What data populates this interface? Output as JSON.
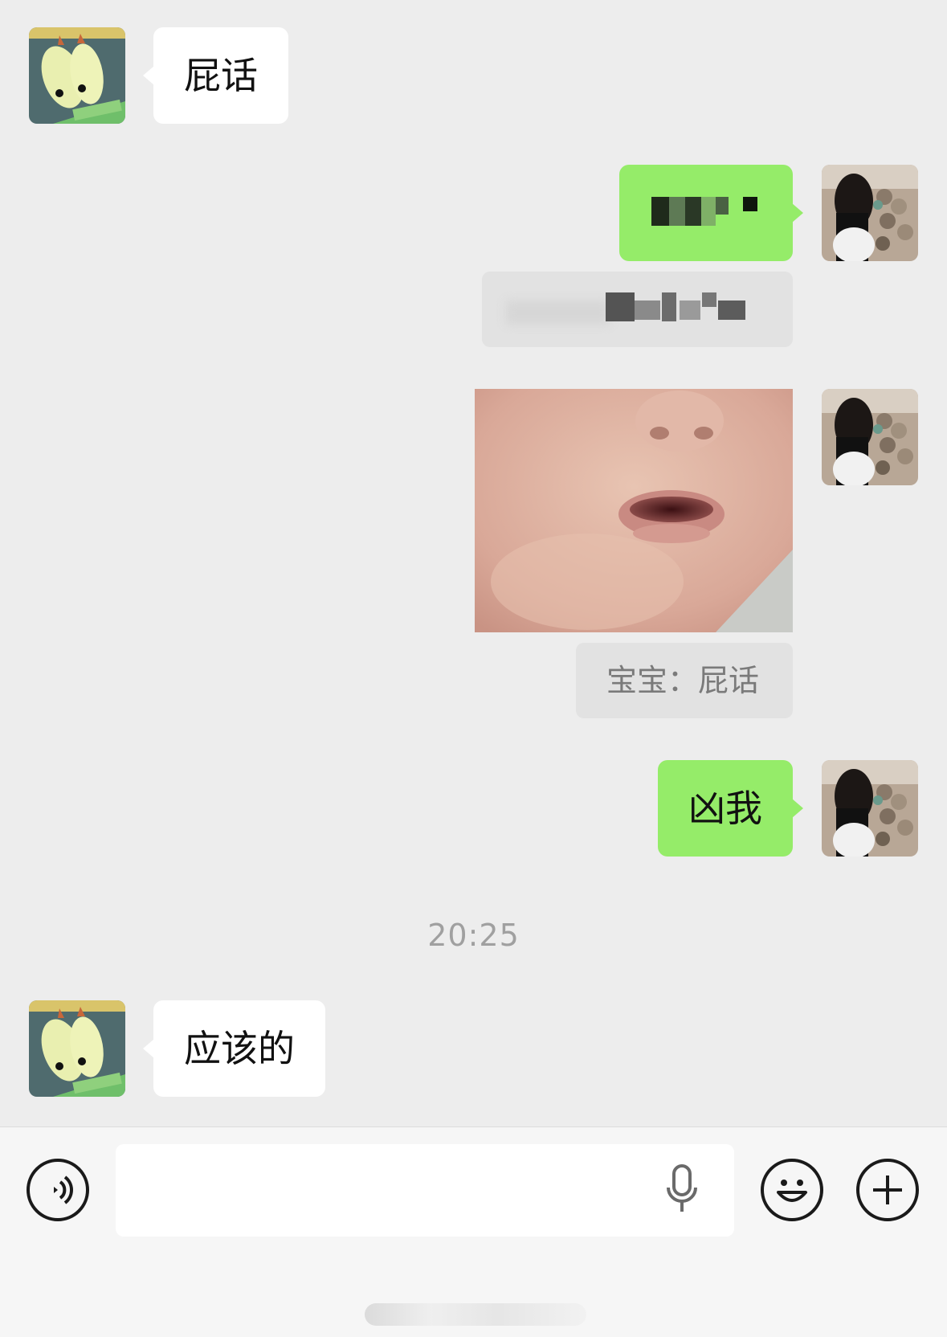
{
  "messages": [
    {
      "side": "left",
      "text": "屁话"
    },
    {
      "side": "right",
      "text": ""
    },
    {
      "side": "right",
      "type": "image"
    },
    {
      "side": "right",
      "text": "凶我"
    },
    {
      "side": "left",
      "text": "应该的"
    }
  ],
  "quotes": {
    "blurred": "",
    "image_quote": "宝宝：屁话"
  },
  "timestamp": "20:25",
  "input": {
    "placeholder": ""
  },
  "icons": {
    "voice": "voice-toggle-icon",
    "mic": "microphone-icon",
    "emoji": "emoji-icon",
    "plus": "plus-icon"
  },
  "colors": {
    "background": "#ededed",
    "right_bubble": "#95ec69",
    "left_bubble": "#ffffff",
    "quote_bg": "#e2e2e2",
    "timestamp": "#a0a0a0"
  }
}
